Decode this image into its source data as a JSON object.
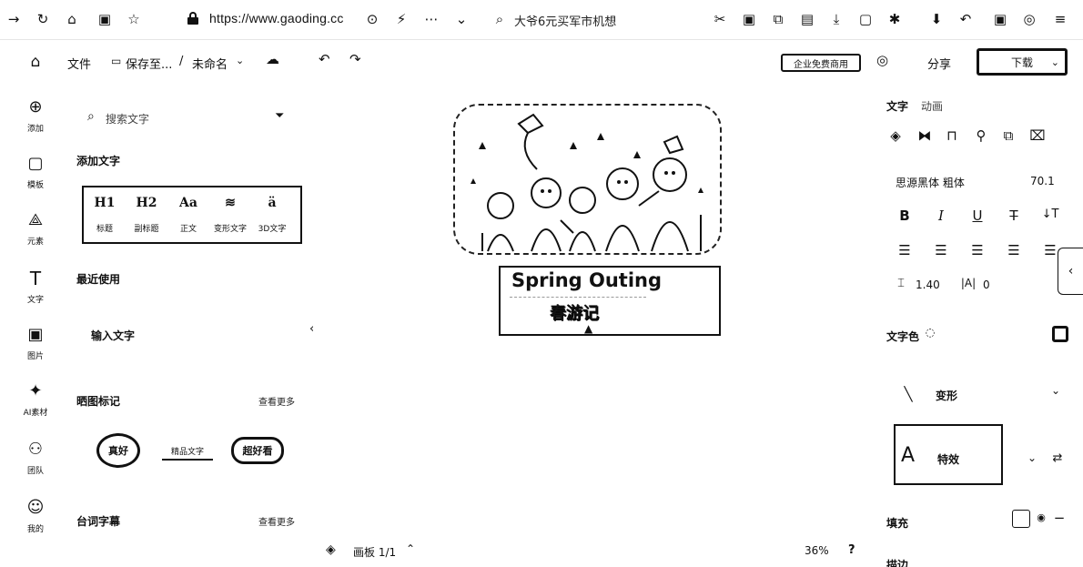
{
  "browser": {
    "url": "https://www.gaoding.cc",
    "search_text": "大爷6元买军市机想"
  },
  "header": {
    "file_label": "文件",
    "save_label": "保存至...",
    "separator": "/",
    "doc_name": "未命名",
    "badge_label": "企业免费商用",
    "share_label": "分享",
    "download_label": "下载"
  },
  "rail": [
    {
      "label": "添加",
      "icon": "plus-circle-icon",
      "glyph": "⊕"
    },
    {
      "label": "模板",
      "icon": "template-icon",
      "glyph": "▢"
    },
    {
      "label": "元素",
      "icon": "shapes-icon",
      "glyph": "⟁"
    },
    {
      "label": "文字",
      "icon": "text-icon",
      "glyph": "T"
    },
    {
      "label": "图片",
      "icon": "image-icon",
      "glyph": "▣"
    },
    {
      "label": "AI素材",
      "icon": "ai-icon",
      "glyph": "✦"
    },
    {
      "label": "团队",
      "icon": "team-icon",
      "glyph": "⚇"
    },
    {
      "label": "我的",
      "icon": "user-icon",
      "glyph": "☺"
    }
  ],
  "panel": {
    "search_placeholder": "搜索文字",
    "add_text_title": "添加文字",
    "text_styles": [
      {
        "glyph": "H1",
        "label": "标题"
      },
      {
        "glyph": "H2",
        "label": "副标题"
      },
      {
        "glyph": "Aa",
        "label": "正文"
      },
      {
        "glyph": "≋",
        "label": "变形文字"
      },
      {
        "glyph": "ä",
        "label": "3D文字"
      }
    ],
    "recent_title": "最近使用",
    "input_text_label": "输入文字",
    "stickers_title": "晒图标记",
    "see_more": "查看更多",
    "stickers": [
      "真好",
      "精品文字",
      "超好看"
    ],
    "subtitles_title": "台词字幕",
    "see_more_2": "查看更多"
  },
  "canvas": {
    "title_en": "Spring Outing",
    "title_cn": "春游记"
  },
  "bottom": {
    "page_label": "画板 1/1",
    "zoom": "36%",
    "help": "?"
  },
  "right": {
    "tab_text": "文字",
    "tab_anim": "动画",
    "font_name": "思源黑体 粗体",
    "font_size": "70.1",
    "line_height": "1.40",
    "letter_spacing": "0",
    "text_color_label": "文字色",
    "transform_label": "变形",
    "effect_label": "特效",
    "fill_label": "填充",
    "stroke_label": "描边"
  }
}
